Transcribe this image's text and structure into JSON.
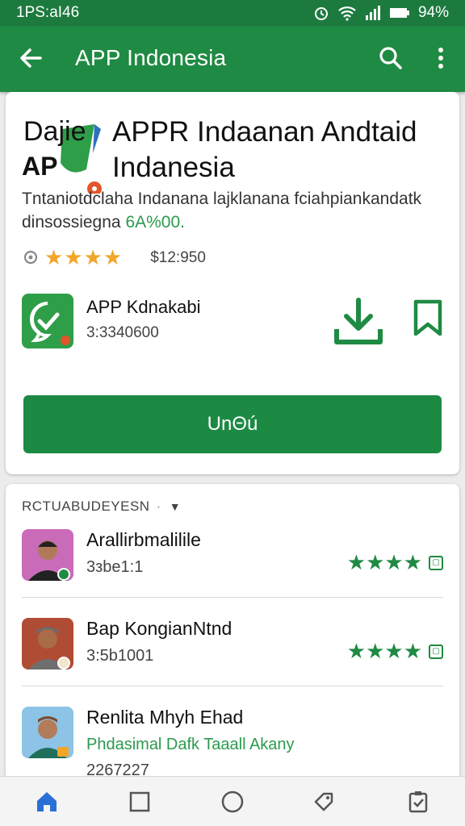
{
  "status_bar": {
    "time": "1PS:aI46",
    "battery": "94%"
  },
  "app_bar": {
    "title": "APP Indonesia"
  },
  "hero": {
    "logo_line1": "Dajie",
    "logo_line2": "AP",
    "title": "APPR Indaanan Andtaid Indanesia",
    "description": "Tntaniotdclaha Indanana lajklanana fciahpiankandatk dinsossiegna",
    "description_accent": "6A%00.",
    "price": "$12:950"
  },
  "app": {
    "name": "APP Kdnakabi",
    "subtitle": "3:3340600"
  },
  "install_label": "UnΘú",
  "section_title": "RCTUABUDEYESN",
  "list": [
    {
      "name": "Arallirbmalilile",
      "subtitle": "3зbe1:1"
    },
    {
      "name": "Bap KongianNtnd",
      "subtitle": "3:5b1001"
    },
    {
      "name": "Renlita Mhyh Ehad",
      "subtitle": "Phdasimal Dafk Taaall Akany",
      "extra": "2267227"
    }
  ],
  "colors": {
    "primary": "#1f8a43",
    "status": "#1d7a3e",
    "star": "#f1a62a"
  },
  "bottom_nav": [
    "home-icon",
    "square-icon",
    "circle-icon",
    "tag-icon",
    "clipboard-check-icon"
  ]
}
